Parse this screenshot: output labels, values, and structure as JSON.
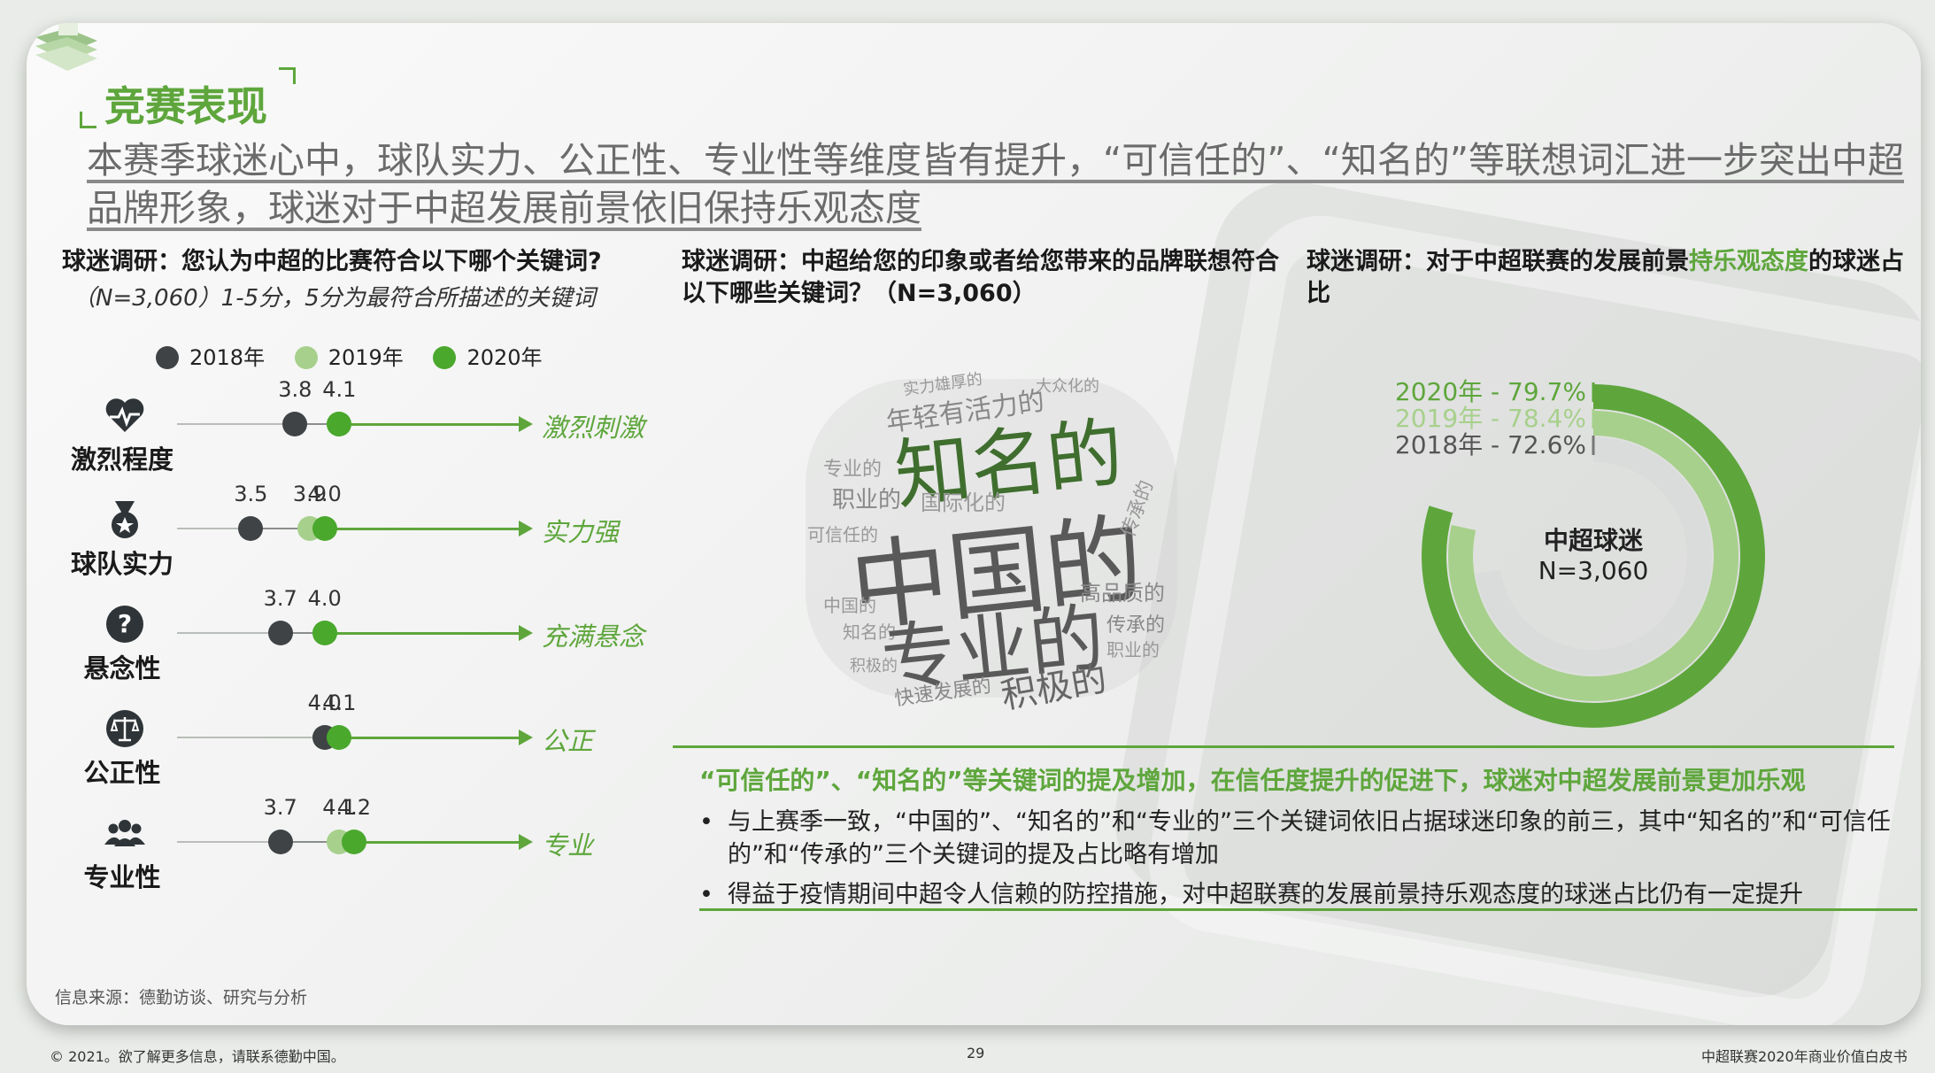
{
  "title": "竞赛表现",
  "headline": "本赛季球迷心中，球队实力、公正性、专业性等维度皆有提升，“可信任的”、“知名的”等联想词汇进一步突出中超品牌形象，球迷对于中超发展前景依旧保持乐观态度",
  "left": {
    "question": "球迷调研：您认为中超的比赛符合以下哪个关键词?",
    "sub": "（N=3,060）1-5分，5分为最符合所描述的关键词",
    "legend": [
      {
        "label": "2018年",
        "color": "#3f4346"
      },
      {
        "label": "2019年",
        "color": "#a7d08c"
      },
      {
        "label": "2020年",
        "color": "#4aa82d"
      }
    ],
    "rows": [
      {
        "label": "激烈程度",
        "icon": "heartbeat-icon",
        "v2018": 3.8,
        "v2019": 4.1,
        "v2020": 4.1,
        "labels": [
          "3.8",
          "4.1"
        ],
        "desc": "激烈刺激"
      },
      {
        "label": "球队实力",
        "icon": "medal-icon",
        "v2018": 3.5,
        "v2019": 3.9,
        "v2020": 4.0,
        "labels": [
          "3.5",
          "3.9",
          "4.0"
        ],
        "desc": "实力强"
      },
      {
        "label": "悬念性",
        "icon": "question-icon",
        "v2018": 3.7,
        "v2019": 4.0,
        "v2020": 4.0,
        "labels": [
          "3.7",
          "4.0"
        ],
        "desc": "充满悬念"
      },
      {
        "label": "公正性",
        "icon": "scale-icon",
        "v2018": 4.0,
        "v2019": 4.0,
        "v2020": 4.1,
        "labels": [
          "4.0",
          "4.1"
        ],
        "desc": "公正"
      },
      {
        "label": "专业性",
        "icon": "people-icon",
        "v2018": 3.7,
        "v2019": 4.1,
        "v2020": 4.2,
        "labels": [
          "3.7",
          "4.1",
          "4.2"
        ],
        "desc": "专业"
      }
    ]
  },
  "middle": {
    "question": "球迷调研：中超给您的印象或者给您带来的品牌联想符合以下哪些关键词？（N=3,060）",
    "words": {
      "big1": "知名的",
      "big2": "中国的",
      "big3": "专业的",
      "m1": "年轻有活力的",
      "m2": "积极的",
      "m3": "快速发展的",
      "m4": "高品质的",
      "m5": "传承的",
      "m6": "职业的",
      "m7": "国际化的",
      "m8": "可信任的",
      "s1": "实力雄厚的",
      "s2": "大众化的",
      "s3": "专业的",
      "s4": "中国的",
      "s5": "知名的",
      "s6": "积极的",
      "s7": "职业的",
      "s8": "传承的"
    }
  },
  "right": {
    "question_a": "球迷调研：对于中超联赛的发展前景",
    "question_hl": "持乐观态度",
    "question_b": "的球迷占比",
    "center1": "中超球迷",
    "center2": "N=3,060",
    "rings": [
      {
        "label": "2020年 - 79.7%",
        "value": 79.7,
        "color": "#5ea63c"
      },
      {
        "label": "2019年 - 78.4%",
        "value": 78.4,
        "color": "#a7d08c"
      },
      {
        "label": "2018年 - 72.6%",
        "value": 72.6,
        "color": "#dadcdb"
      }
    ]
  },
  "bottom": {
    "highlight": "“可信任的”、“知名的”等关键词的提及增加，在信任度提升的促进下，球迷对中超发展前景更加乐观",
    "bullets": [
      "与上赛季一致，“中国的”、“知名的”和“专业的”三个关键词依旧占据球迷印象的前三，其中“知名的”和“可信任的”和“传承的”三个关键词的提及占比略有增加",
      "得益于疫情期间中超令人信赖的防控措施，对中超联赛的发展前景持乐观态度的球迷占比仍有一定提升"
    ]
  },
  "source": "信息来源：德勤访谈、研究与分析",
  "footer": {
    "left": "© 2021。欲了解更多信息，请联系德勤中国。",
    "page": "29",
    "right": "中超联赛2020年商业价值白皮书"
  }
}
